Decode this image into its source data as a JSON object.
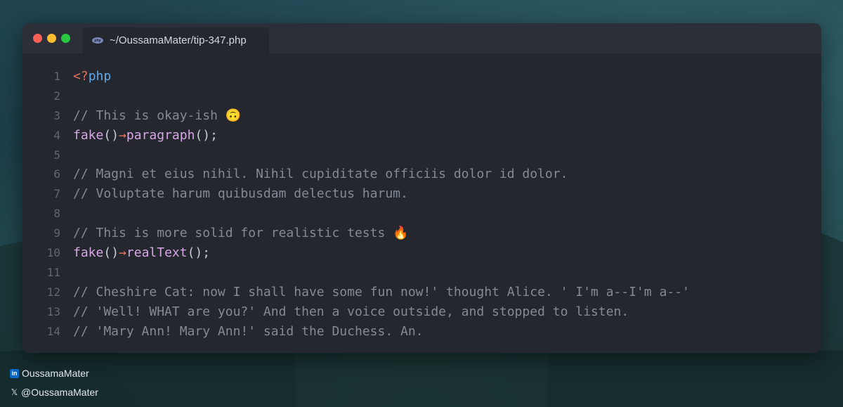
{
  "window": {
    "tab_title": "~/OussamaMater/tip-347.php",
    "tab_icon": "php-file-icon"
  },
  "code_lines": [
    {
      "n": "1",
      "tokens": [
        {
          "t": "<?",
          "c": "c-tag"
        },
        {
          "t": "php",
          "c": "c-kw"
        }
      ]
    },
    {
      "n": "2",
      "tokens": []
    },
    {
      "n": "3",
      "tokens": [
        {
          "t": "// This is okay-ish 🙃",
          "c": "c-comment"
        }
      ]
    },
    {
      "n": "4",
      "tokens": [
        {
          "t": "fake",
          "c": "c-fn"
        },
        {
          "t": "()",
          "c": "c-punc"
        },
        {
          "t": "→",
          "c": "c-arrow"
        },
        {
          "t": "paragraph",
          "c": "c-fn"
        },
        {
          "t": "();",
          "c": "c-punc"
        }
      ]
    },
    {
      "n": "5",
      "tokens": []
    },
    {
      "n": "6",
      "tokens": [
        {
          "t": "// Magni et eius nihil. Nihil cupiditate officiis dolor id dolor.",
          "c": "c-comment"
        }
      ]
    },
    {
      "n": "7",
      "tokens": [
        {
          "t": "// Voluptate harum quibusdam delectus harum.",
          "c": "c-comment"
        }
      ]
    },
    {
      "n": "8",
      "tokens": []
    },
    {
      "n": "9",
      "tokens": [
        {
          "t": "// This is more solid for realistic tests 🔥",
          "c": "c-comment"
        }
      ]
    },
    {
      "n": "10",
      "tokens": [
        {
          "t": "fake",
          "c": "c-fn"
        },
        {
          "t": "()",
          "c": "c-punc"
        },
        {
          "t": "→",
          "c": "c-arrow"
        },
        {
          "t": "realText",
          "c": "c-fn"
        },
        {
          "t": "();",
          "c": "c-punc"
        }
      ]
    },
    {
      "n": "11",
      "tokens": []
    },
    {
      "n": "12",
      "tokens": [
        {
          "t": "// Cheshire Cat: now I shall have some fun now!' thought Alice. ' I'm a--I'm a--'",
          "c": "c-comment"
        }
      ]
    },
    {
      "n": "13",
      "tokens": [
        {
          "t": "// 'Well! WHAT are you?' And then a voice outside, and stopped to listen.",
          "c": "c-comment"
        }
      ]
    },
    {
      "n": "14",
      "tokens": [
        {
          "t": "// 'Mary Ann! Mary Ann!' said the Duchess. An.",
          "c": "c-comment"
        }
      ]
    }
  ],
  "social": {
    "linkedin_label": "OussamaMater",
    "linkedin_icon": "linkedin-icon",
    "x_label": "@OussamaMater",
    "x_icon": "x-icon"
  },
  "colors": {
    "editor_bg": "#24272e",
    "titlebar_bg": "#2c2f37",
    "traffic_red": "#fe5f57",
    "traffic_yellow": "#febc2e",
    "traffic_green": "#28c840",
    "comment": "#848a94",
    "function": "#d7a6e6",
    "arrow": "#e5745f",
    "php_keyword": "#61a8e8"
  }
}
